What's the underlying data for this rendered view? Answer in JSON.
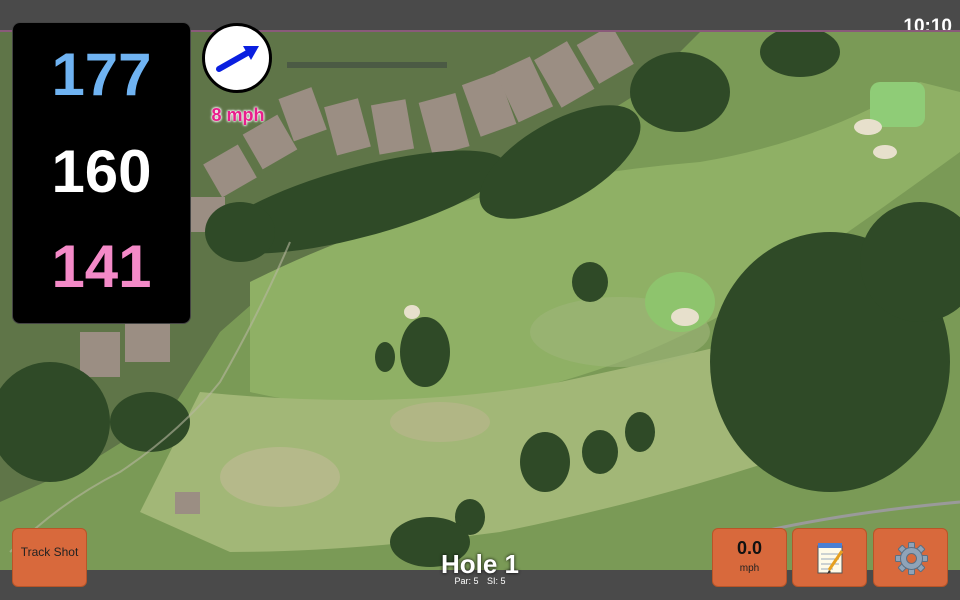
{
  "status": {
    "time": "10:10"
  },
  "distances": {
    "back": "177",
    "middle": "160",
    "front": "141"
  },
  "wind": {
    "label": "8 mph",
    "direction_icon": "wind-arrow-icon"
  },
  "buttons": {
    "track_shot": "Track Shot",
    "wind_speed_value": "0.0",
    "wind_speed_unit": "mph",
    "notes_icon": "notepad-icon",
    "settings_icon": "gear-icon"
  },
  "hole": {
    "title": "Hole 1",
    "par": "Par: 5",
    "si": "SI: 5"
  },
  "colors": {
    "back": "#6fb3f2",
    "middle": "#ffffff",
    "front": "#f48ac8",
    "wind_text": "#e91e8c",
    "button": "#d8693c"
  }
}
